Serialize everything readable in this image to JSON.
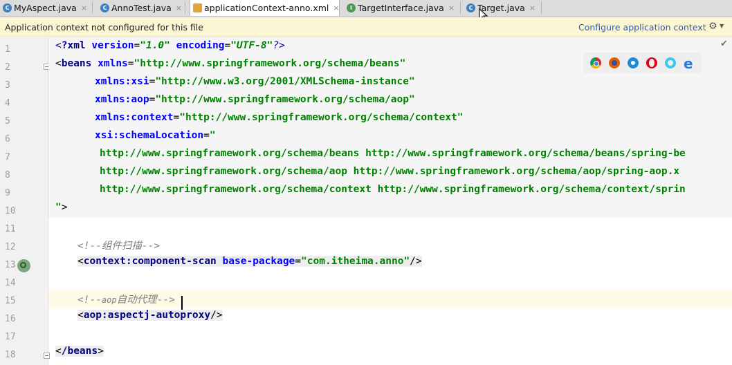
{
  "tabs": [
    {
      "label": "MyAspect.java",
      "icon": "c-class-icon"
    },
    {
      "label": "AnnoTest.java",
      "icon": "c-class-icon"
    },
    {
      "label": "applicationContext-anno.xml",
      "icon": "xml-file-icon"
    },
    {
      "label": "TargetInterface.java",
      "icon": "interface-icon"
    },
    {
      "label": "Target.java",
      "icon": "c-class-icon"
    }
  ],
  "tab_icons": {
    "class_letter": "C",
    "interface_letter": "I"
  },
  "close_glyph": "×",
  "banner": {
    "message": "Application context not configured for this file",
    "link": "Configure application context"
  },
  "line_numbers": [
    "1",
    "2",
    "3",
    "4",
    "5",
    "6",
    "7",
    "8",
    "9",
    "10",
    "11",
    "12",
    "13",
    "14",
    "15",
    "16",
    "17",
    "18"
  ],
  "code": {
    "l1_decl": "?xml",
    "l1_version_attr": "version",
    "l1_version_val": "\"1.0\"",
    "l1_encoding_attr": "encoding",
    "l1_encoding_val": "\"UTF-8\"",
    "l2_tag": "beans",
    "l2_attr": "xmlns",
    "l2_val": "\"http://www.springframework.org/schema/beans\"",
    "l3_attr": "xmlns:xsi",
    "l3_val": "\"http://www.w3.org/2001/XMLSchema-instance\"",
    "l4_attr": "xmlns:aop",
    "l4_val": "\"http://www.springframework.org/schema/aop\"",
    "l5_attr": "xmlns:context",
    "l5_val": "\"http://www.springframework.org/schema/context\"",
    "l6_attr": "xsi:schemaLocation",
    "l6_val": "\"",
    "l7_val": "http://www.springframework.org/schema/beans http://www.springframework.org/schema/beans/spring-be",
    "l8_val": "http://www.springframework.org/schema/aop http://www.springframework.org/schema/aop/spring-aop.x",
    "l9_val": "http://www.springframework.org/schema/context http://www.springframework.org/schema/context/sprin",
    "l10_val": "\"",
    "l12_comment": "<!--组件扫描-->",
    "l13_tag": "context:component-scan",
    "l13_attr": "base-package",
    "l13_val": "\"com.itheima.anno\"",
    "l15_comment_start": "<!--",
    "l15_comment_keyword": "aop",
    "l15_comment_end": "自动代理-->",
    "l16_tag": "aop:aspectj-autoproxy",
    "l18_tag": "/beans"
  },
  "colors": {
    "tag": "#000080",
    "attribute": "#0000ff",
    "value": "#008000",
    "comment": "#808080",
    "banner": "#fcf6d4",
    "link": "#2a5db0"
  },
  "browser_icons": [
    "chrome-icon",
    "firefox-icon",
    "safari-icon",
    "opera-icon",
    "ie-icon",
    "edge-icon"
  ]
}
